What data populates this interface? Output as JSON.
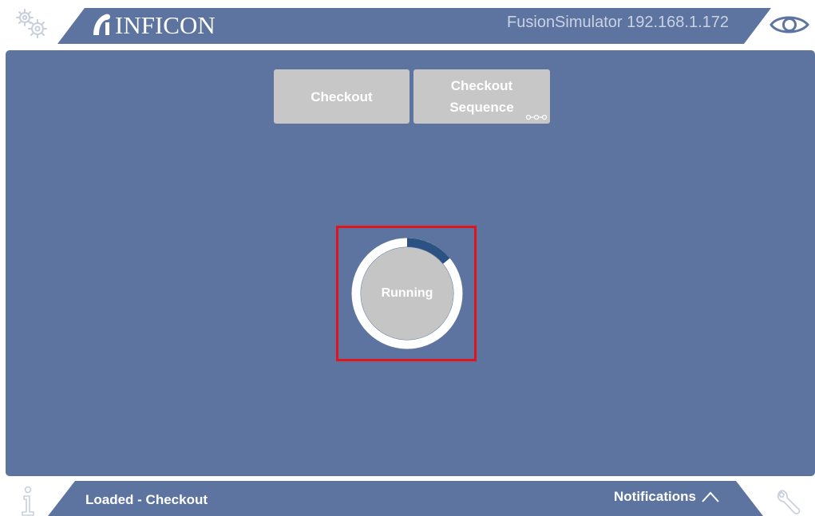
{
  "header": {
    "brand": "INFICON",
    "device_title": "FusionSimulator 192.168.1.172",
    "settings_icon": "gears-icon",
    "view_icon": "eye-icon"
  },
  "tabs": [
    {
      "label": "Checkout"
    },
    {
      "label_line1": "Checkout",
      "label_line2": "Sequence",
      "icon": "sequence-icon"
    }
  ],
  "status": {
    "label": "Running",
    "progress": 0.14,
    "ring_color": "#ffffff",
    "progress_color": "#2c5283",
    "highlight_color": "#e5121a"
  },
  "footer": {
    "status_text": "Loaded - Checkout",
    "notifications_label": "Notifications",
    "info_icon": "info-icon",
    "service_icon": "wrench-icon"
  },
  "colors": {
    "panel": "#5d74a0",
    "button": "#c7c7c7",
    "accent_red": "#e5121a"
  }
}
